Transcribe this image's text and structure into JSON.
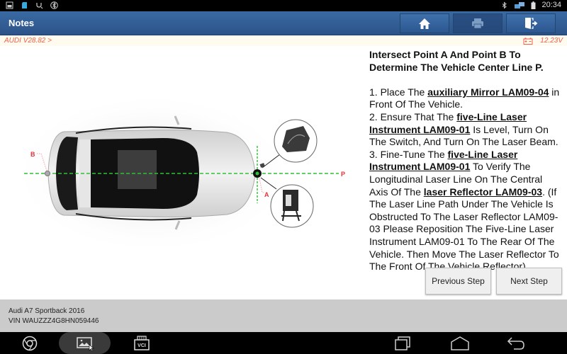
{
  "status_bar": {
    "left_icons": [
      "gallery-notification-icon",
      "sd-card-icon",
      "usb-debug-icon",
      "bluetooth-circle-icon"
    ],
    "right_icons": [
      "bluetooth-icon",
      "network-icon",
      "battery-icon"
    ],
    "time": "20:34"
  },
  "header": {
    "title": "Notes",
    "buttons": [
      {
        "name": "home-button",
        "icon": "home-icon"
      },
      {
        "name": "print-button",
        "icon": "printer-icon"
      },
      {
        "name": "exit-button",
        "icon": "exit-door-icon"
      }
    ]
  },
  "info_bar": {
    "version": "AUDI V28.82 >",
    "battery_voltage": "12.23V"
  },
  "diagram": {
    "labels": {
      "point_a": "A",
      "point_b": "B",
      "line_p": "P"
    },
    "colors": {
      "laser_line": "#2fbf3a",
      "label": "#e8303a"
    }
  },
  "instructions": {
    "heading": "Intersect Point A And Point B To Determine The Vehicle Center Line P.",
    "steps": [
      {
        "pre": "1. Place The ",
        "bold": "auxiliary Mirror LAM09-04",
        "post": " in Front Of The Vehicle."
      },
      {
        "pre": "2. Ensure That The ",
        "bold": "five-Line Laser Instrument LAM09-01",
        "post": " Is Level, Turn On The Switch, And Turn On The Laser Beam."
      },
      {
        "pre": "3. Fine-Tune The ",
        "bold": "five-Line Laser Instrument LAM09-01",
        "post": " To Verify The Longitudinal Laser Line On The Central Axis Of The "
      },
      {
        "pre": "",
        "bold": "laser Reflector LAM09-03",
        "post": ". (If The Laser Line Path Under The Vehicle Is Obstructed To The Laser Reflector LAM09-03 Please Reposition The Five-Line Laser Instrument LAM09-01 To The Rear Of The Vehicle. Then Move The Laser Reflector To The Front Of The Vehicle Reflector)"
      }
    ]
  },
  "step_buttons": {
    "previous": "Previous Step",
    "next": "Next Step"
  },
  "vehicle": {
    "model": "Audi A7 Sportback 2016",
    "vin": "VIN WAUZZZ4G8HN059446"
  },
  "nav_bar": {
    "app_icons": [
      "chrome-icon",
      "gallery-icon",
      "vci-icon"
    ],
    "vci_label": "VCI",
    "system_icons": [
      "recent-apps-icon",
      "home-nav-icon",
      "back-icon"
    ]
  }
}
